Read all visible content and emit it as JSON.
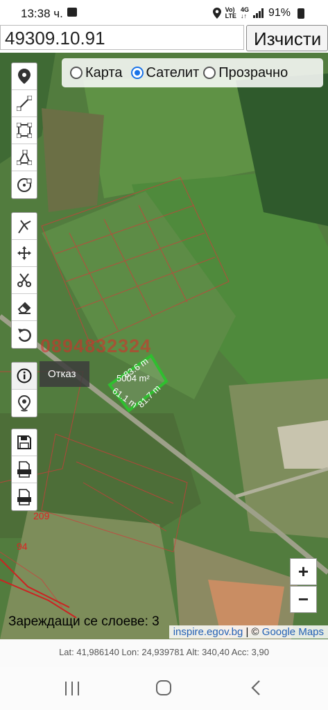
{
  "status": {
    "time": "13:38 ч.",
    "network_top": "Vo)",
    "network_bottom": "LTE",
    "lte_top": "4G",
    "lte_bottom": "↓↑",
    "battery": "91%"
  },
  "search": {
    "value": "49309.10.91",
    "clear_label": "Изчисти"
  },
  "map_types": {
    "map_label": "Карта",
    "satellite_label": "Сателит",
    "transparent_label": "Прозрачно",
    "selected": "Сателит"
  },
  "tools": {
    "group1": [
      "marker-tool-icon",
      "line-tool-icon",
      "rectangle-tool-icon",
      "polygon-tool-icon",
      "circle-tool-icon"
    ],
    "group2": [
      "snap-tool-icon",
      "move-tool-icon",
      "cut-tool-icon",
      "eraser-tool-icon",
      "undo-tool-icon"
    ],
    "group3": [
      "info-icon",
      "location-icon"
    ],
    "group4": [
      "save-icon",
      "shp-export-icon",
      "json-export-icon"
    ]
  },
  "tooltip": {
    "text": "Отказ"
  },
  "overlay": {
    "watermark": "0894832324",
    "area": "5004 m²",
    "side_top": "83.6 m",
    "side_left": "61.1 m",
    "side_right": "81.7 m",
    "parcel_a": "209",
    "parcel_b": "94"
  },
  "zoom": {
    "in_label": "+",
    "out_label": "−"
  },
  "loading": {
    "text": "Зареждащи се слоеве: 3"
  },
  "attribution": {
    "link1": "inspire.egov.bg",
    "sep": " | © ",
    "link2": "Google Maps"
  },
  "gps": {
    "text": "Lat: 41,986140 Lon: 24,939781 Alt: 340,40 Acc: 3,90"
  },
  "colors": {
    "accent": "#1a73e8",
    "parcel_lines": "#d23a3a",
    "measured_polygon": "#2fbf2f"
  }
}
